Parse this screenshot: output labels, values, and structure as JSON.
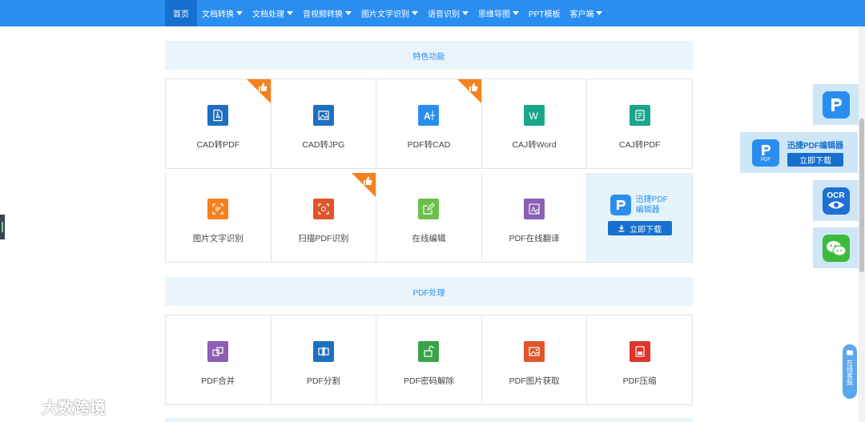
{
  "nav": {
    "items": [
      {
        "label": "首页",
        "dropdown": false
      },
      {
        "label": "文档转换",
        "dropdown": true
      },
      {
        "label": "文档处理",
        "dropdown": true
      },
      {
        "label": "音视频转换",
        "dropdown": true
      },
      {
        "label": "图片文字识别",
        "dropdown": true
      },
      {
        "label": "语音识别",
        "dropdown": true
      },
      {
        "label": "思维导图",
        "dropdown": true
      },
      {
        "label": "PPT模板",
        "dropdown": false
      },
      {
        "label": "客户端",
        "dropdown": true
      }
    ]
  },
  "sections": {
    "features_title": "特色功能",
    "pdf_title": "PDF处理"
  },
  "features": {
    "row1": [
      {
        "label": "CAD转PDF",
        "icon": "pdf-file-icon",
        "color": "#1f6fbf",
        "hot": true
      },
      {
        "label": "CAD转JPG",
        "icon": "image-icon",
        "color": "#1f6fbf",
        "hot": false
      },
      {
        "label": "PDF转CAD",
        "icon": "cad-icon",
        "color": "#2a8ef0",
        "hot": true
      },
      {
        "label": "CAJ转Word",
        "icon": "word-icon",
        "color": "#1aa68a",
        "hot": false
      },
      {
        "label": "CAJ转PDF",
        "icon": "document-icon",
        "color": "#1aa68a",
        "hot": false
      }
    ],
    "row2": [
      {
        "label": "图片文字识别",
        "icon": "scan-text-icon",
        "color": "#f5821f",
        "hot": false
      },
      {
        "label": "扫描PDF识别",
        "icon": "scan-icon",
        "color": "#e0552a",
        "hot": true
      },
      {
        "label": "在线编辑",
        "icon": "edit-icon",
        "color": "#6cc04a",
        "hot": false
      },
      {
        "label": "PDF在线翻译",
        "icon": "translate-icon",
        "color": "#8a5fb4",
        "hot": false
      }
    ]
  },
  "promo": {
    "name": "迅捷PDF编辑器",
    "button": "立即下载"
  },
  "pdf_tools": [
    {
      "label": "PDF合并",
      "icon": "merge-icon",
      "color": "#8a5fb4"
    },
    {
      "label": "PDF分割",
      "icon": "split-icon",
      "color": "#1f6fbf"
    },
    {
      "label": "PDF密码解除",
      "icon": "unlock-icon",
      "color": "#3aa34a"
    },
    {
      "label": "PDF图片获取",
      "icon": "picture-icon",
      "color": "#e0552a"
    },
    {
      "label": "PDF压缩",
      "icon": "compress-icon",
      "color": "#e0352a"
    }
  ],
  "side": {
    "editor_name": "迅捷PDF编辑器",
    "editor_button": "立即下载",
    "ocr_label": "OCR",
    "pdf_badge": "PDF",
    "service_label": "在线客服"
  },
  "watermark": "大数跨境"
}
